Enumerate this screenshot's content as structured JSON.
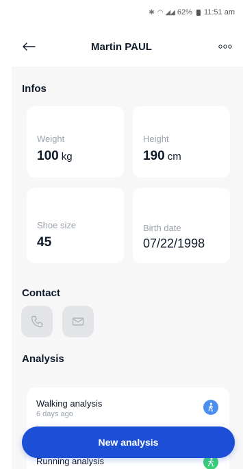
{
  "status_bar": {
    "battery": "62%",
    "time": "11:51 am"
  },
  "header": {
    "title": "Martin PAUL",
    "back_icon": "arrow-left-icon",
    "more_icon": "more-dots-icon"
  },
  "infos": {
    "title": "Infos",
    "cards": [
      {
        "label": "Weight",
        "value": "100",
        "unit": "kg"
      },
      {
        "label": "Height",
        "value": "190",
        "unit": "cm"
      },
      {
        "label": "Shoe size",
        "value": "45",
        "unit": ""
      },
      {
        "label": "Birth date",
        "value": "07/22/1998",
        "unit": ""
      }
    ]
  },
  "contact": {
    "title": "Contact",
    "phone_icon": "phone-icon",
    "mail_icon": "mail-icon"
  },
  "analysis": {
    "title": "Analysis",
    "items": [
      {
        "name": "Walking analysis",
        "ago": "6 days ago",
        "icon": "walking-icon",
        "color": "#4a8ef0"
      },
      {
        "name": "Running analysis",
        "ago": "",
        "icon": "running-icon",
        "color": "#3ccf7a"
      }
    ]
  },
  "cta": {
    "label": "New analysis",
    "color": "#1c4fd6"
  }
}
